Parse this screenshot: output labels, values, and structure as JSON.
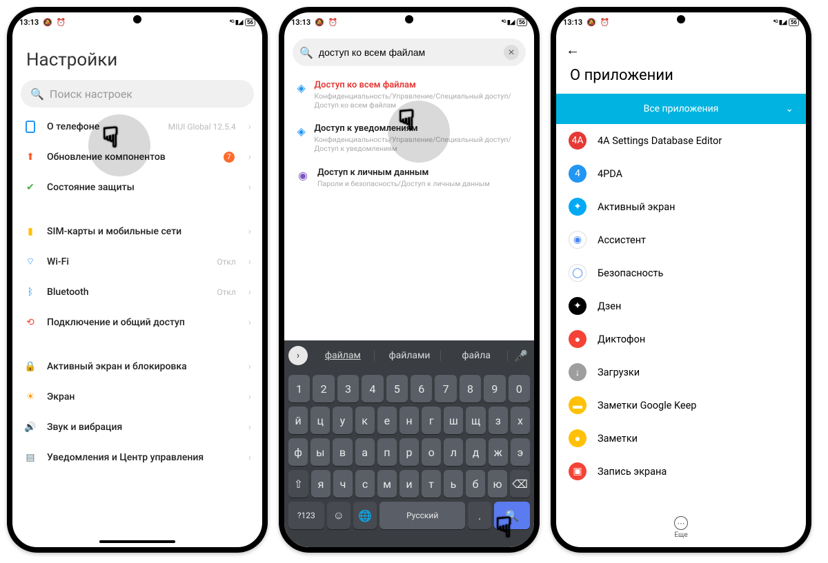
{
  "statusbar": {
    "time": "13:13",
    "battery": "56"
  },
  "phone1": {
    "title": "Настройки",
    "searchPlaceholder": "Поиск настроек",
    "items": [
      {
        "label": "О телефоне",
        "trail": "MIUI Global 12.5.4",
        "iconColor": "#2196f3",
        "badge": null
      },
      {
        "label": "Обновление компонентов",
        "trail": "",
        "iconColor": "#ff5722",
        "badge": "7"
      },
      {
        "label": "Состояние защиты",
        "trail": "",
        "iconColor": "#4caf50",
        "badge": null
      }
    ],
    "items2": [
      {
        "label": "SIM-карты и мобильные сети",
        "trail": "",
        "iconColor": "#ffc107"
      },
      {
        "label": "Wi-Fi",
        "trail": "Откл",
        "iconColor": "#2196f3"
      },
      {
        "label": "Bluetooth",
        "trail": "Откл",
        "iconColor": "#2196f3"
      },
      {
        "label": "Подключение и общий доступ",
        "trail": "",
        "iconColor": "#f44336"
      }
    ],
    "items3": [
      {
        "label": "Активный экран и блокировка",
        "iconColor": "#f44336"
      },
      {
        "label": "Экран",
        "iconColor": "#ff9800"
      },
      {
        "label": "Звук и вибрация",
        "iconColor": "#4caf50"
      },
      {
        "label": "Уведомления и Центр управления",
        "iconColor": "#607d8b"
      }
    ]
  },
  "phone2": {
    "searchText": "доступ ко всем файлам",
    "results": [
      {
        "title": "Доступ ко всем файлам",
        "sub": "Конфиденциальность/Управление/Специальный доступ/Доступ ко всем файлам",
        "red": true,
        "icon": "🛡"
      },
      {
        "title": "Доступ к уведомлениям",
        "sub": "Конфиденциальность/Управление/Специальный доступ/Доступ к уведомлениям",
        "red": false,
        "icon": "🛡"
      },
      {
        "title": "Доступ к личным данным",
        "sub": "Пароли и безопасность/Доступ к личным данным",
        "red": false,
        "icon": "☉"
      }
    ],
    "suggestions": [
      "файлам",
      "файлами",
      "файла"
    ],
    "kbRow1": [
      "1",
      "2",
      "3",
      "4",
      "5",
      "6",
      "7",
      "8",
      "9",
      "0"
    ],
    "kbRow2": [
      "й",
      "ц",
      "у",
      "к",
      "е",
      "н",
      "г",
      "ш",
      "щ",
      "з",
      "х"
    ],
    "kbRow3": [
      "ф",
      "ы",
      "в",
      "а",
      "п",
      "р",
      "о",
      "л",
      "д",
      "ж",
      "э"
    ],
    "kbRow4": [
      "я",
      "ч",
      "с",
      "м",
      "и",
      "т",
      "ь",
      "б",
      "ю"
    ],
    "kbNumKey": "?123",
    "kbLang": "Русский"
  },
  "phone3": {
    "title": "О приложении",
    "dropdown": "Все приложения",
    "apps": [
      {
        "name": "4A Settings Database Editor",
        "bg": "#e53935",
        "txt": "4A"
      },
      {
        "name": "4PDA",
        "bg": "#2196f3",
        "txt": "4"
      },
      {
        "name": "Активный экран",
        "bg": "#03a9f4",
        "txt": "✦"
      },
      {
        "name": "Ассистент",
        "bg": "#ffffff",
        "txt": "◉"
      },
      {
        "name": "Безопасность",
        "bg": "#ffffff",
        "txt": "◯"
      },
      {
        "name": "Дзен",
        "bg": "#000000",
        "txt": "✦"
      },
      {
        "name": "Диктофон",
        "bg": "#f44336",
        "txt": "●"
      },
      {
        "name": "Загрузки",
        "bg": "#9e9e9e",
        "txt": "↓"
      },
      {
        "name": "Заметки Google Keep",
        "bg": "#ffc107",
        "txt": "▬"
      },
      {
        "name": "Заметки",
        "bg": "#ffc107",
        "txt": "●"
      },
      {
        "name": "Запись экрана",
        "bg": "#f44336",
        "txt": "▣"
      }
    ],
    "moreLabel": "Еще"
  }
}
